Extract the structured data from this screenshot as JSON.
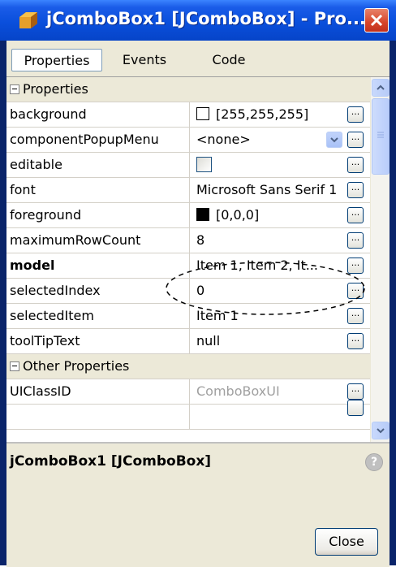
{
  "window": {
    "title": "jComboBox1 [JComboBox] - Pro...",
    "close_icon": "close-icon"
  },
  "tabs": [
    {
      "label": "Properties",
      "active": true
    },
    {
      "label": "Events",
      "active": false
    },
    {
      "label": "Code",
      "active": false
    }
  ],
  "sections": {
    "properties": "Properties",
    "other": "Other Properties"
  },
  "properties": [
    {
      "name": "background",
      "value": "[255,255,255]",
      "swatch": "#ffffff"
    },
    {
      "name": "componentPopupMenu",
      "value": "<none>"
    },
    {
      "name": "editable",
      "value": ""
    },
    {
      "name": "font",
      "value": "Microsoft Sans Serif 1"
    },
    {
      "name": "foreground",
      "value": "[0,0,0]",
      "swatch": "#000000"
    },
    {
      "name": "maximumRowCount",
      "value": "8"
    },
    {
      "name": "model",
      "value": "Item 1, Item 2, It..."
    },
    {
      "name": "selectedIndex",
      "value": "0"
    },
    {
      "name": "selectedItem",
      "value": "Item 1"
    },
    {
      "name": "toolTipText",
      "value": "null"
    }
  ],
  "other_properties": [
    {
      "name": "UIClassID",
      "value": "ComboBoxUI"
    }
  ],
  "ellipsis_label": "...",
  "description": {
    "title": "jComboBox1 [JComboBox]",
    "help_icon": "?"
  },
  "buttons": {
    "close": "Close"
  }
}
